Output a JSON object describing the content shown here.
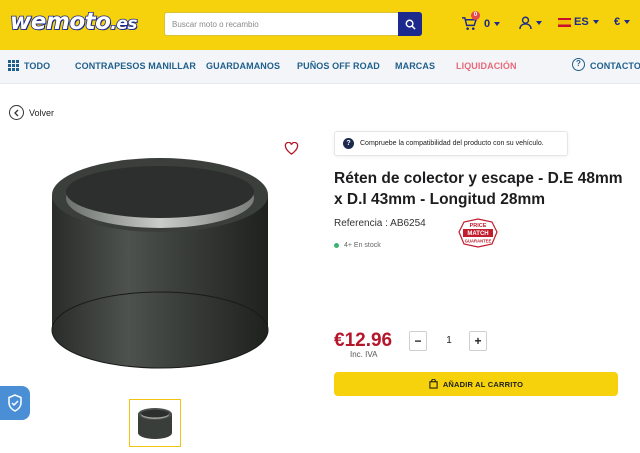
{
  "header": {
    "logo": "wemoto",
    "logo_tld": ".es",
    "search_placeholder": "Buscar moto o recambio",
    "cart_count": "0",
    "cart_badge": "0",
    "language": "ES",
    "currency": "€"
  },
  "nav": {
    "items": [
      {
        "label": "TODO"
      },
      {
        "label": "CONTRAPESOS MANILLAR"
      },
      {
        "label": "GUARDAMANOS"
      },
      {
        "label": "PUÑOS OFF ROAD"
      },
      {
        "label": "MARCAS"
      },
      {
        "label": "LIQUIDACIÓN"
      }
    ],
    "contact": "CONTACTO"
  },
  "back_label": "Volver",
  "product": {
    "compat_notice": "Compruebe la compatibilidad del producto con su vehículo.",
    "title": "Réten de colector y escape - D.E 48mm x D.I 43mm - Longitud 28mm",
    "reference": "Referencia : AB6254",
    "stock": "4+ En stock",
    "badge_lines": [
      "PRICE",
      "MATCH",
      "GUARANTEE"
    ],
    "price": "€12.96",
    "tax_note": "Inc. IVA",
    "quantity": "1",
    "minus": "−",
    "plus": "+",
    "add_to_cart": "AÑADIR AL CARRITO"
  },
  "colors": {
    "brand_yellow": "#f5d20b",
    "brand_blue": "#1b2a8c",
    "price_red": "#b5172a",
    "sale_pink": "#e86a7a",
    "stock_green": "#3cb371"
  }
}
